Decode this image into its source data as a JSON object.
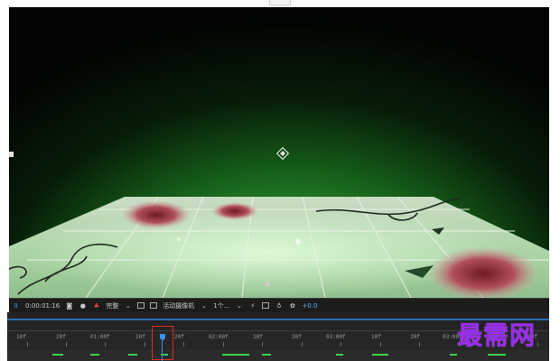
{
  "toolbar": {
    "timecode": "0:00:01:16",
    "resolution": "完整",
    "camera": "活动摄像机",
    "views": "1个...",
    "exposure": "+0.0"
  },
  "ruler": {
    "labels": [
      "10f",
      "20f",
      "01:00f",
      "10f",
      "20f",
      "02:00f",
      "10f",
      "20f",
      "03:00f",
      "10f",
      "20f",
      "03:00f",
      "10f",
      "20f"
    ]
  },
  "watermark": "最需网",
  "icons": {
    "region": "region-of-interest-icon",
    "snapshot": "camera-snapshot-icon",
    "show_snapshot": "show-snapshot-icon",
    "color": "color-channel-icon",
    "grid": "grid-icon",
    "transparency": "transparency-grid-icon",
    "fast_preview": "fast-preview-icon",
    "timeline": "timeline-icon",
    "flowchart": "flowchart-icon",
    "reset_exposure": "exposure-icon"
  },
  "colors": {
    "background_green": "#2c9d30",
    "playhead": "#3a8ee8",
    "keyframe": "#3ad24a",
    "highlight_box": "#e0301e",
    "watermark": "#9a2cf0"
  }
}
